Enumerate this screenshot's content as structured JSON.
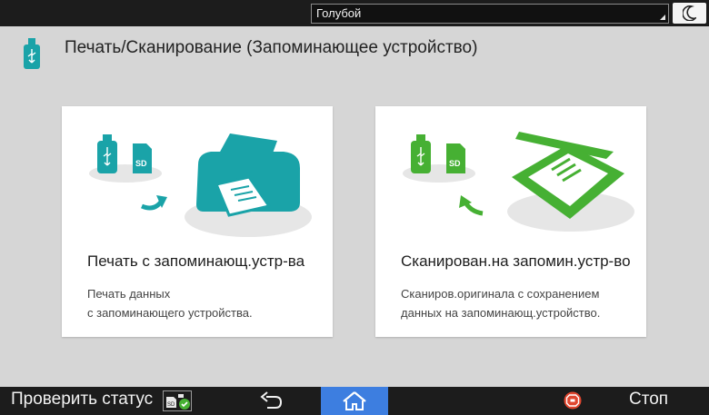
{
  "topbar": {
    "theme_value": "Голубой"
  },
  "header": {
    "title": "Печать/Сканирование (Запоминающее устройство)",
    "icon": "usb-stick-icon"
  },
  "cards": [
    {
      "title": "Печать с запоминающ.устр-ва",
      "desc_line1": "Печать данных",
      "desc_line2": "с запоминающего устройства.",
      "illustration": "usb-sd-to-printer"
    },
    {
      "title": "Сканирован.на запомин.устр-во",
      "desc_line1": "Сканиров.оригинала с сохранением",
      "desc_line2": "данных на запоминающ.устройство.",
      "illustration": "scanner-to-usb-sd"
    }
  ],
  "bottombar": {
    "check_status_label": "Проверить статус",
    "stop_label": "Стоп"
  },
  "colors": {
    "teal": "#1aa3a8",
    "green": "#46b033",
    "home_blue": "#3d7ee0",
    "stop_red": "#e0462f"
  }
}
